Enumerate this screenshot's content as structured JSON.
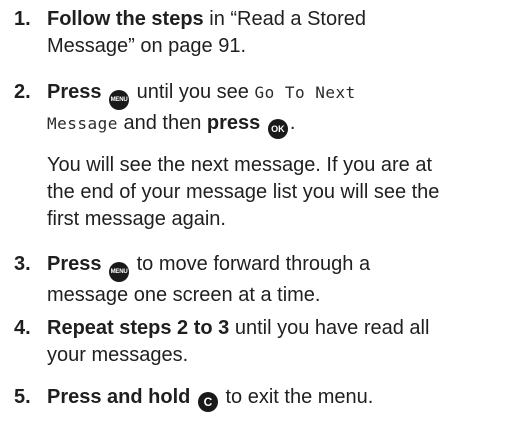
{
  "steps": [
    {
      "num": "1.",
      "bold": "Follow the steps",
      "text_line1": " in “Read a Stored",
      "text_line2": "Message” on page 91."
    },
    {
      "num": "2.",
      "bold": "Press",
      "text_a": " until you see ",
      "lcd_a": "Go To Next",
      "lcd_b": "Message",
      "text_b": " and then ",
      "bold_b": "press",
      "text_c": "."
    },
    {
      "para_line1": "You will see the next message. If you are at",
      "para_line2": "the end of your message list you will see the",
      "para_line3": "first message again."
    },
    {
      "num": "3.",
      "bold": "Press",
      "text_line1": " to move forward through a",
      "text_line2": "message one screen at a time."
    },
    {
      "num": "4.",
      "bold": "Repeat steps 2 to 3",
      "text_line1": " until you have read all",
      "text_line2": "your messages."
    },
    {
      "num": "5.",
      "bold": "Press and hold",
      "text_line1": " to exit the menu."
    }
  ],
  "buttons": {
    "menu": "MENU",
    "ok": "OK",
    "c": "C"
  }
}
